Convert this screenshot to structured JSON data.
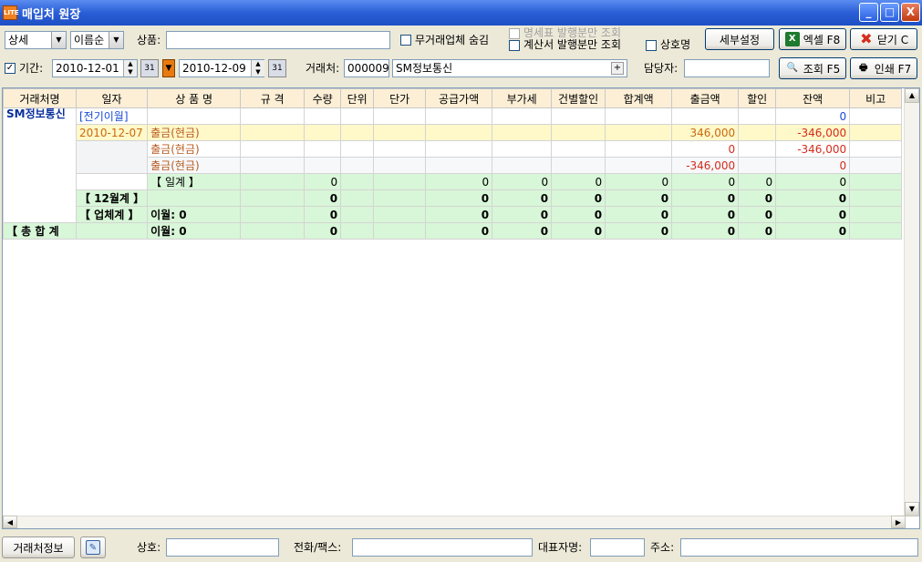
{
  "window": {
    "title": "매입처 원장",
    "app_icon_text": "LITE",
    "minimize": "_",
    "maximize": "□",
    "close": "X"
  },
  "toolbar1": {
    "view_mode": "상세",
    "sort_order": "이름순",
    "product_label": "상품:",
    "product_value": "",
    "hide_no_trade_label": "무거래업체 숨김",
    "statement_only_label": "명세표 발행분만 조회",
    "invoice_only_label": "계산서 발행분만 조회",
    "company_name_label": "상호명",
    "detail_settings": "세부설정",
    "excel_button": "엑셀 F8",
    "close_button": "닫기 C"
  },
  "toolbar2": {
    "period_label": "기간:",
    "date_from": "2010-12-01",
    "date_to": "2010-12-09",
    "calendar_icon_text": "31",
    "vendor_label": "거래처:",
    "vendor_code": "000009",
    "vendor_name": "SM정보통신",
    "vendor_add": "+",
    "manager_label": "담당자:",
    "manager_value": "",
    "search_button": "조회 F5",
    "print_button": "인쇄 F7"
  },
  "grid": {
    "columns": [
      "거래처명",
      "일자",
      "상 품 명",
      "규 격",
      "수량",
      "단위",
      "단가",
      "공급가액",
      "부가세",
      "건별할인",
      "합계액",
      "출금액",
      "할인",
      "잔액",
      "비고"
    ],
    "vendor_name": "SM정보통신",
    "rows": [
      {
        "date": "[전기이월]",
        "product": "",
        "qty": "",
        "supply": "",
        "vat": "",
        "disc_each": "",
        "total": "",
        "payout": "",
        "discount": "",
        "balance": "0"
      },
      {
        "date": "2010-12-07",
        "product": "출금(현금)",
        "qty": "",
        "supply": "",
        "vat": "",
        "disc_each": "",
        "total": "",
        "payout": "346,000",
        "discount": "",
        "balance": "-346,000"
      },
      {
        "date": "",
        "product": "출금(현금)",
        "qty": "",
        "supply": "",
        "vat": "",
        "disc_each": "",
        "total": "",
        "payout": "0",
        "discount": "",
        "balance": "-346,000"
      },
      {
        "date": "",
        "product": "출금(현금)",
        "qty": "",
        "supply": "",
        "vat": "",
        "disc_each": "",
        "total": "",
        "payout": "-346,000",
        "discount": "",
        "balance": "0"
      },
      {
        "date": "",
        "product": "【 일계 】",
        "qty": "0",
        "supply": "0",
        "vat": "0",
        "disc_each": "0",
        "total": "0",
        "payout": "0",
        "discount": "0",
        "balance": "0"
      },
      {
        "date": "【 12월계 】",
        "product": "",
        "qty": "0",
        "supply": "0",
        "vat": "0",
        "disc_each": "0",
        "total": "0",
        "payout": "0",
        "discount": "0",
        "balance": "0"
      },
      {
        "date": "【 업체계 】",
        "product": "이월: 0",
        "qty": "0",
        "supply": "0",
        "vat": "0",
        "disc_each": "0",
        "total": "0",
        "payout": "0",
        "discount": "0",
        "balance": "0"
      }
    ],
    "grand_total": {
      "label": "【 총 합 계",
      "product": "이월: 0",
      "qty": "0",
      "supply": "0",
      "vat": "0",
      "disc_each": "0",
      "total": "0",
      "payout": "0",
      "discount": "0",
      "balance": "0"
    }
  },
  "bottom": {
    "vendor_info_button": "거래처정보",
    "company_label": "상호:",
    "phone_fax_label": "전화/팩스:",
    "ceo_label": "대표자명:",
    "address_label": "주소:"
  },
  "colors": {
    "header_bg": "#fcefd6",
    "yellow_row": "#fff8c8",
    "green_row": "#d8f6d8",
    "red_text": "#d42c1c",
    "blue_text": "#1a4bd6"
  }
}
